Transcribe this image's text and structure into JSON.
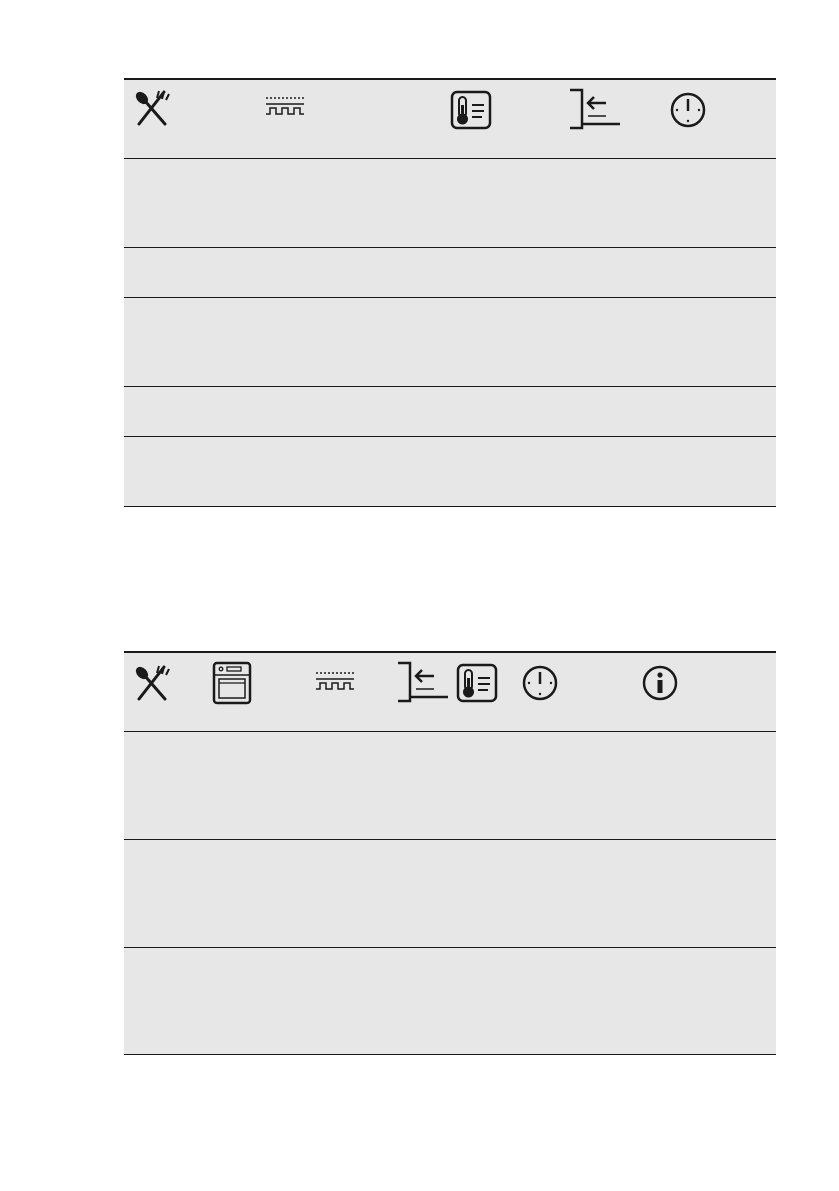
{
  "tables": [
    {
      "id": "table1",
      "header_icons": [
        "food-icon",
        "grill-heating-icon",
        "temperature-icon",
        "shelf-position-icon",
        "time-icon"
      ],
      "row_count": 5
    },
    {
      "id": "table2",
      "header_icons": [
        "food-icon",
        "oven-function-icon",
        "grill-heating-icon",
        "shelf-position-icon",
        "temperature-icon",
        "time-icon",
        "information-icon"
      ],
      "row_count": 3
    }
  ],
  "colors": {
    "background": "#e7e7e7",
    "lines": "#1a1a1a"
  }
}
